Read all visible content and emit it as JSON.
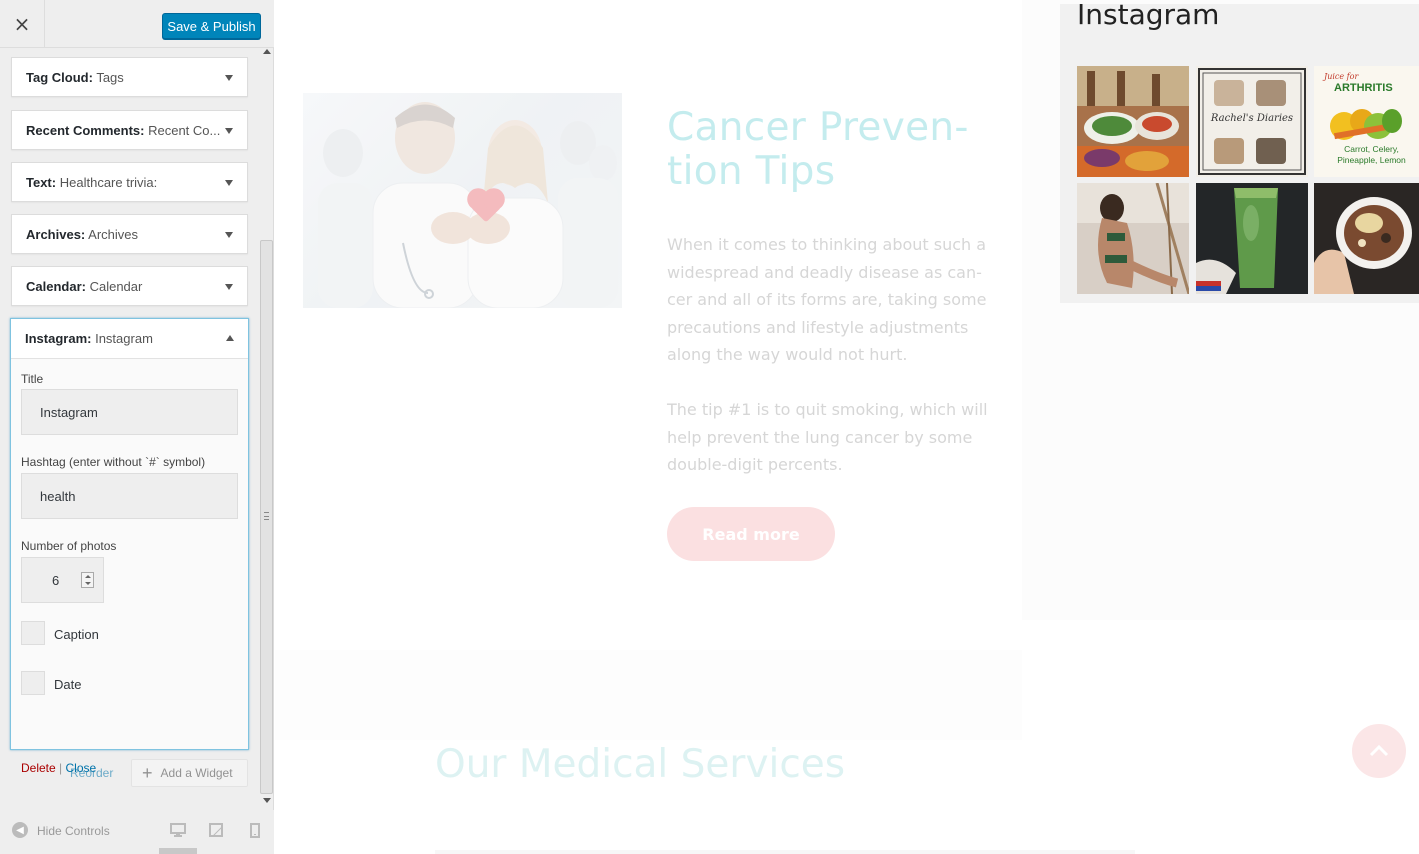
{
  "toolbar": {
    "close_label": "×",
    "save_label": "Save & Publish"
  },
  "widgets": [
    {
      "type": "Tag Cloud:",
      "name": "Tags"
    },
    {
      "type": "Recent Comments:",
      "name": "Recent Co..."
    },
    {
      "type": "Text:",
      "name": "Healthcare trivia:"
    },
    {
      "type": "Archives:",
      "name": "Archives"
    },
    {
      "type": "Calendar:",
      "name": "Calendar"
    }
  ],
  "instagram_widget": {
    "type": "Instagram:",
    "name": "Instagram",
    "title_label": "Title",
    "title_value": "Instagram",
    "hashtag_label": "Hashtag (enter without `#` symbol)",
    "hashtag_value": "health",
    "photos_label": "Number of photos",
    "photos_value": "6",
    "caption_label": "Caption",
    "caption_checked": false,
    "date_label": "Date",
    "date_checked": false,
    "delete_label": "Delete",
    "separator": "|",
    "close_label": "Close"
  },
  "actions": {
    "reorder_label": "Reorder",
    "add_widget_label": "Add a Widget"
  },
  "footer": {
    "hide_controls_label": "Hide Controls",
    "devices": [
      "desktop-icon",
      "tablet-icon",
      "mobile-icon"
    ]
  },
  "preview": {
    "post_title": "Cancer Preven-tion Tips",
    "paragraph1": "When it comes to thinking about such a widespread and deadly disease as can-cer and all of its forms are, taking some precautions and lifestyle adjustments along the way would not hurt.",
    "paragraph2": "The tip #1 is to quit smoking, which will help prevent the lung cancer by some double-digit percents.",
    "read_more_label": "Read more",
    "services_title": "Our Medical Services",
    "instagram_heading": "Instagram",
    "thumb_texts": {
      "diaries": "Rachel's Diaries",
      "juice_for": "Juice for",
      "arthritis": "ARTHRITIS",
      "ingredients": "Carrot, Celery, Pineapple, Lemon"
    }
  },
  "colors": {
    "accent": "#0085ba",
    "title_teal": "#c4ecee",
    "button_pink": "#fbe0e1",
    "delete_red": "#a00",
    "link_blue": "#0073aa"
  }
}
